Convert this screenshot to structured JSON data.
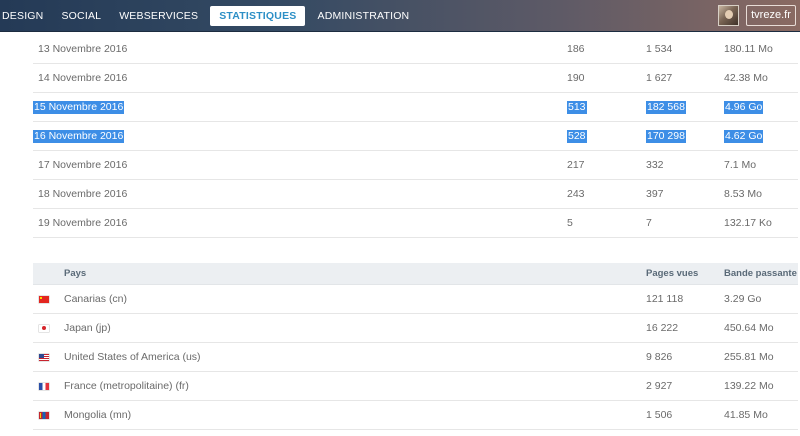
{
  "nav": {
    "items": [
      "DESIGN",
      "SOCIAL",
      "WEBSERVICES",
      "STATISTIQUES",
      "ADMINISTRATION"
    ],
    "active": "STATISTIQUES"
  },
  "user": {
    "name": "tvreze.fr"
  },
  "daily_stats": [
    {
      "date": "13 Novembre 2016",
      "visits": "186",
      "pages": "1 534",
      "bandwidth": "180.11 Mo",
      "selected": false
    },
    {
      "date": "14 Novembre 2016",
      "visits": "190",
      "pages": "1 627",
      "bandwidth": "42.38 Mo",
      "selected": false
    },
    {
      "date": "15 Novembre 2016",
      "visits": "513",
      "pages": "182 568",
      "bandwidth": "4.96 Go",
      "selected": true
    },
    {
      "date": "16 Novembre 2016",
      "visits": "528",
      "pages": "170 298",
      "bandwidth": "4.62 Go",
      "selected": true
    },
    {
      "date": "17 Novembre 2016",
      "visits": "217",
      "pages": "332",
      "bandwidth": "7.1 Mo",
      "selected": false
    },
    {
      "date": "18 Novembre 2016",
      "visits": "243",
      "pages": "397",
      "bandwidth": "8.53 Mo",
      "selected": false
    },
    {
      "date": "19 Novembre 2016",
      "visits": "5",
      "pages": "7",
      "bandwidth": "132.17 Ko",
      "selected": false
    }
  ],
  "countries": {
    "headers": {
      "country": "Pays",
      "pages": "Pages vues",
      "bandwidth": "Bande passante"
    },
    "rows": [
      {
        "flag": "cn",
        "name": "Canarias (cn)",
        "pages": "121 118",
        "bandwidth": "3.29 Go"
      },
      {
        "flag": "jp",
        "name": "Japan (jp)",
        "pages": "16 222",
        "bandwidth": "450.64 Mo"
      },
      {
        "flag": "us",
        "name": "United States of America (us)",
        "pages": "9 826",
        "bandwidth": "255.81 Mo"
      },
      {
        "flag": "fr",
        "name": "France (metropolitaine) (fr)",
        "pages": "2 927",
        "bandwidth": "139.22 Mo"
      },
      {
        "flag": "mn",
        "name": "Mongolia (mn)",
        "pages": "1 506",
        "bandwidth": "41.85 Mo"
      }
    ]
  }
}
